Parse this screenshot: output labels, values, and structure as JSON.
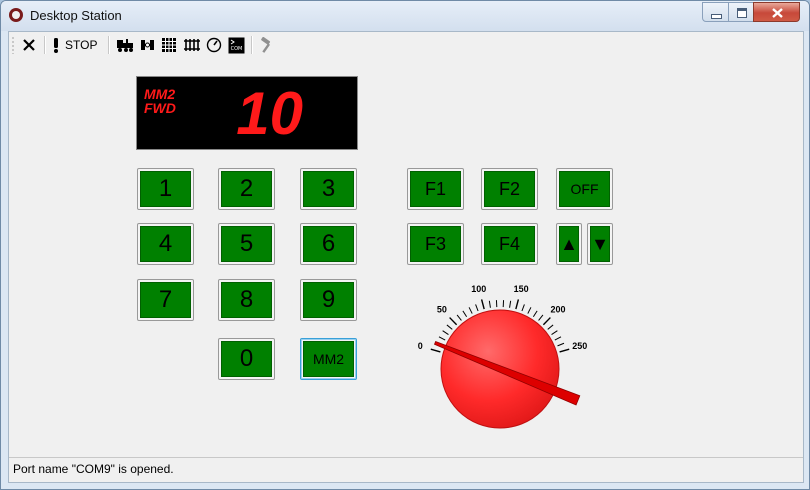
{
  "window": {
    "title": "Desktop Station"
  },
  "toolbar": {
    "stop_label": "STOP"
  },
  "display": {
    "mode_line1": "MM2",
    "mode_line2": "FWD",
    "speed": "10"
  },
  "keypad": [
    "1",
    "2",
    "3",
    "4",
    "5",
    "6",
    "7",
    "8",
    "9",
    "0"
  ],
  "protocol_button": "MM2",
  "functions": {
    "f1": "F1",
    "f2": "F2",
    "f3": "F3",
    "f4": "F4",
    "off": "OFF",
    "up": "▲",
    "down": "▼"
  },
  "dial": {
    "ticks": [
      "0",
      "50",
      "100",
      "150",
      "200",
      "250"
    ],
    "min": 0,
    "max": 250,
    "value": 10,
    "knob_color": "#ff2a2a",
    "needle_color": "#dd0000"
  },
  "colors": {
    "button_green": "#008000",
    "display_red": "#ff1a1a"
  },
  "status": {
    "message": "Port name \"COM9\" is opened."
  }
}
